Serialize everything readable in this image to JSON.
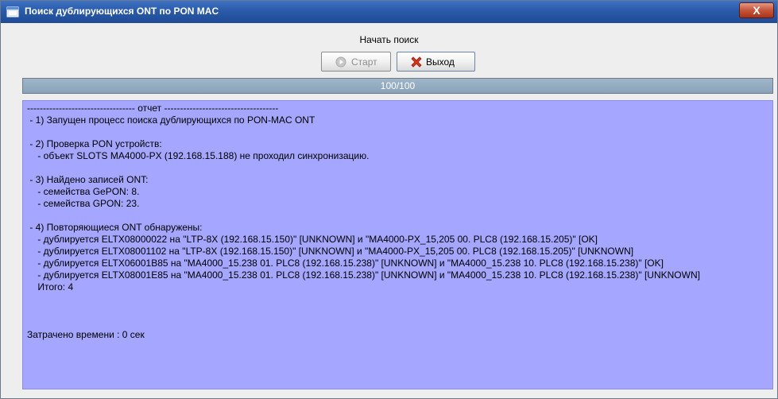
{
  "window": {
    "title": "Поиск дублирующихся ONT по PON MAC",
    "close_label": "X"
  },
  "header": {
    "label": "Начать поиск"
  },
  "toolbar": {
    "start_label": "Старт",
    "exit_label": "Выход"
  },
  "progress": {
    "text": "100/100",
    "fraction": 1.0
  },
  "report": {
    "lines": [
      "---------------------------------- отчет ------------------------------------",
      " - 1) Запущен процесс поиска дублирующихся по PON-MAC ONT",
      "",
      " - 2) Проверка PON устройств:",
      "    - объект SLOTS MA4000-PX (192.168.15.188) не проходил синхронизацию.",
      "",
      " - 3) Найдено записей ONT:",
      "    - семейства GePON: 8.",
      "    - семейства GPON: 23.",
      "",
      " - 4) Повторяющиеся ONT обнаружены:",
      "    - дублируется ELTX08000022 на \"LTP-8X (192.168.15.150)\" [UNKNOWN] и \"MA4000-PX_15,205 00. PLC8 (192.168.15.205)\" [OK]",
      "    - дублируется ELTX08001102 на \"LTP-8X (192.168.15.150)\" [UNKNOWN] и \"MA4000-PX_15,205 00. PLC8 (192.168.15.205)\" [UNKNOWN]",
      "    - дублируется ELTX06001B85 на \"MA4000_15.238 01. PLC8 (192.168.15.238)\" [UNKNOWN] и \"MA4000_15.238 10. PLC8 (192.168.15.238)\" [OK]",
      "    - дублируется ELTX08001E85 на \"MA4000_15.238 01. PLC8 (192.168.15.238)\" [UNKNOWN] и \"MA4000_15.238 10. PLC8 (192.168.15.238)\" [UNKNOWN]",
      "    Итого: 4",
      "",
      "",
      "",
      "Затрачено времени : 0 сек"
    ]
  },
  "colors": {
    "titlebar": "#2a5aa8",
    "report_background": "#a4a6ff",
    "progress_fill": "#8aa3b9"
  },
  "icons": {
    "app": "app-window-icon",
    "start": "start-icon",
    "exit": "exit-x-icon",
    "close": "close-icon"
  }
}
